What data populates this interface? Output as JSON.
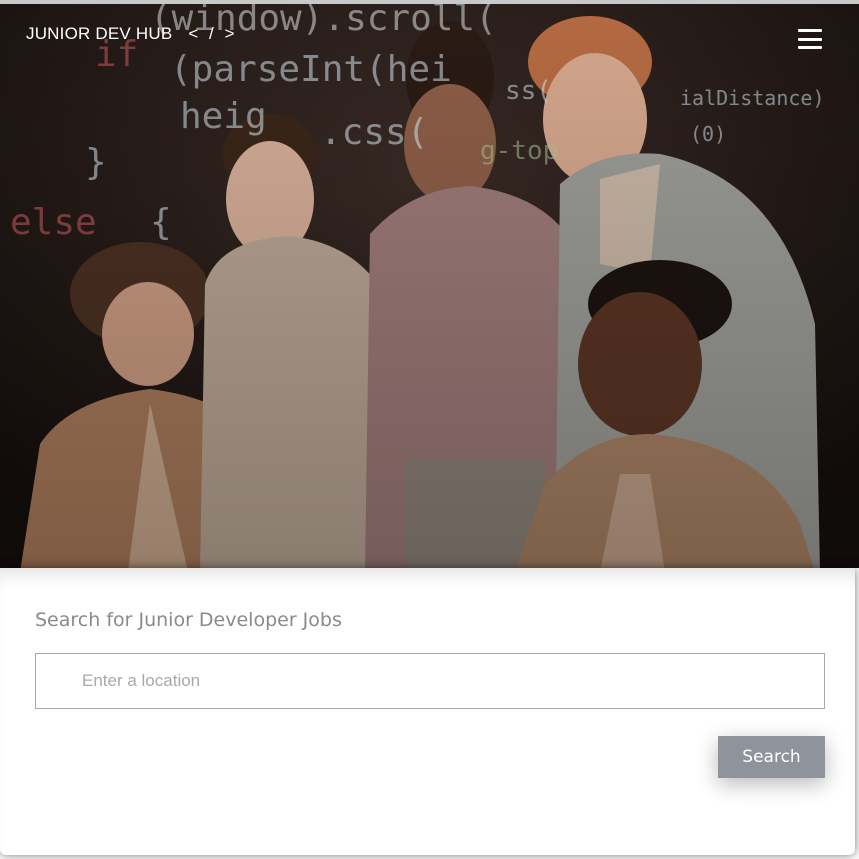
{
  "header": {
    "brand_name": "JUNIOR DEV HUB",
    "brand_mark": "< / >",
    "menu_icon": "hamburger-menu-icon"
  },
  "hero": {
    "background_code_lines": [
      "(window).scroll(",
      "if",
      "(parseInt(hei",
      "heig",
      ".css(",
      "}",
      "else",
      "{",
      "ss(",
      "g-top",
      "ialDistance)",
      "(0)"
    ],
    "photo_description_icon": "team-photo"
  },
  "search": {
    "title": "Search for Junior Developer Jobs",
    "location_placeholder": "Enter a location",
    "location_value": "",
    "button_label": "Search"
  },
  "colors": {
    "button_bg": "#8f939c",
    "title_text": "#8a8a8a",
    "input_border": "#a8a8a8",
    "hero_overlay": "#1b1512"
  }
}
